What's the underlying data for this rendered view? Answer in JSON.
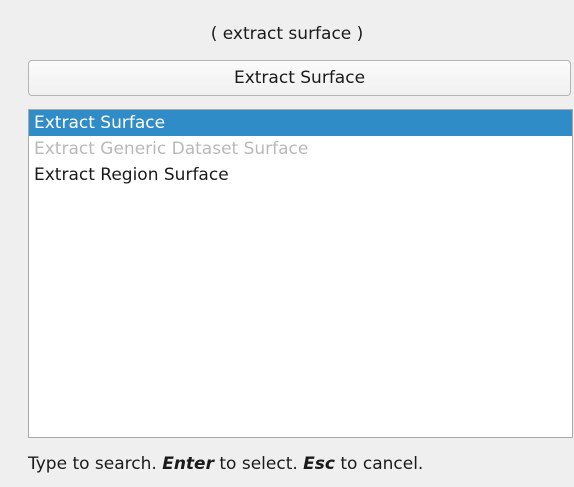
{
  "search": {
    "query_display": "( extract surface )",
    "default_action_label": "Extract Surface"
  },
  "results": [
    {
      "label": "Extract Surface",
      "state": "selected"
    },
    {
      "label": "Extract Generic Dataset Surface",
      "state": "disabled"
    },
    {
      "label": "Extract Region Surface",
      "state": "normal"
    }
  ],
  "hint": {
    "prefix": "Type to search. ",
    "enter_key": "Enter",
    "enter_text": " to select. ",
    "esc_key": "Esc",
    "esc_text": " to cancel."
  },
  "colors": {
    "selection_background": "#308cc6",
    "disabled_text": "#b9b9b9",
    "window_background": "#efefef"
  }
}
